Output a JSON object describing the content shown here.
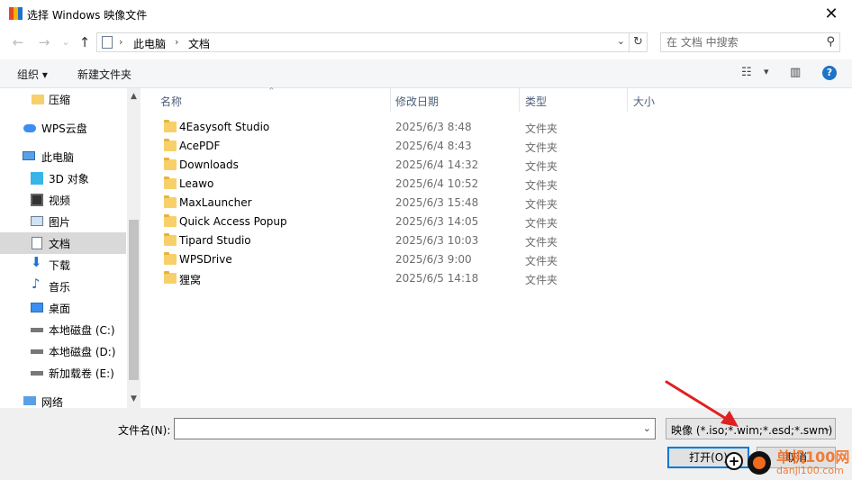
{
  "window": {
    "title": "选择 Windows 映像文件",
    "close_glyph": "✕"
  },
  "nav": {
    "back": "←",
    "forward": "→",
    "recent": "⌄",
    "up": "↑"
  },
  "address": {
    "crumbs": [
      "此电脑",
      "文档"
    ],
    "separator": "›",
    "dropdown": "⌄",
    "refresh": "↻"
  },
  "search": {
    "placeholder": "在 文档 中搜索",
    "icon": "search-icon"
  },
  "toolbar": {
    "organize": "组织",
    "organize_drop": "▾",
    "new_folder": "新建文件夹",
    "view_drop": "▾",
    "help": "?"
  },
  "sidebar": {
    "items": [
      {
        "label": "压缩",
        "icon": "folder-icon",
        "selected": false
      },
      {
        "label": "WPS云盘",
        "icon": "cloud-icon",
        "selected": false
      },
      {
        "label": "此电脑",
        "icon": "computer-icon",
        "selected": false
      },
      {
        "label": "3D 对象",
        "icon": "cube-icon",
        "selected": false
      },
      {
        "label": "视频",
        "icon": "video-icon",
        "selected": false
      },
      {
        "label": "图片",
        "icon": "picture-icon",
        "selected": false
      },
      {
        "label": "文档",
        "icon": "document-icon",
        "selected": true
      },
      {
        "label": "下载",
        "icon": "download-icon",
        "selected": false
      },
      {
        "label": "音乐",
        "icon": "music-icon",
        "selected": false
      },
      {
        "label": "桌面",
        "icon": "desktop-icon",
        "selected": false
      },
      {
        "label": "本地磁盘 (C:)",
        "icon": "drive-icon",
        "selected": false
      },
      {
        "label": "本地磁盘 (D:)",
        "icon": "drive-icon",
        "selected": false
      },
      {
        "label": "新加载卷 (E:)",
        "icon": "drive-icon",
        "selected": false
      },
      {
        "label": "网络",
        "icon": "network-icon",
        "selected": false
      }
    ]
  },
  "filelist": {
    "columns": [
      "名称",
      "修改日期",
      "类型",
      "大小"
    ],
    "sort_glyph": "^",
    "rows": [
      {
        "name": "4Easysoft Studio",
        "date": "2025/6/3 8:48",
        "type": "文件夹"
      },
      {
        "name": "AcePDF",
        "date": "2025/6/4 8:43",
        "type": "文件夹"
      },
      {
        "name": "Downloads",
        "date": "2025/6/4 14:32",
        "type": "文件夹"
      },
      {
        "name": "Leawo",
        "date": "2025/6/4 10:52",
        "type": "文件夹"
      },
      {
        "name": "MaxLauncher",
        "date": "2025/6/3 15:48",
        "type": "文件夹"
      },
      {
        "name": "Quick Access Popup",
        "date": "2025/6/3 14:05",
        "type": "文件夹"
      },
      {
        "name": "Tipard Studio",
        "date": "2025/6/3 10:03",
        "type": "文件夹"
      },
      {
        "name": "WPSDrive",
        "date": "2025/6/3 9:00",
        "type": "文件夹"
      },
      {
        "name": "狸窝",
        "date": "2025/6/5 14:18",
        "type": "文件夹"
      }
    ]
  },
  "bottom": {
    "filename_label": "文件名(N):",
    "filename_value": "",
    "filename_drop": "⌄",
    "filetype": "映像 (*.iso;*.wim;*.esd;*.swm)",
    "filetype_drop": "⌄",
    "open_label": "打开(O)",
    "cancel_label": "取消"
  },
  "watermark": {
    "line1": "单机100网",
    "line2": "danji100.com"
  },
  "colors": {
    "accent": "#0078d7",
    "selection": "#d9d9d9",
    "folder": "#f8d06a",
    "arrow": "#e02020",
    "watermark": "#f26a1b"
  }
}
